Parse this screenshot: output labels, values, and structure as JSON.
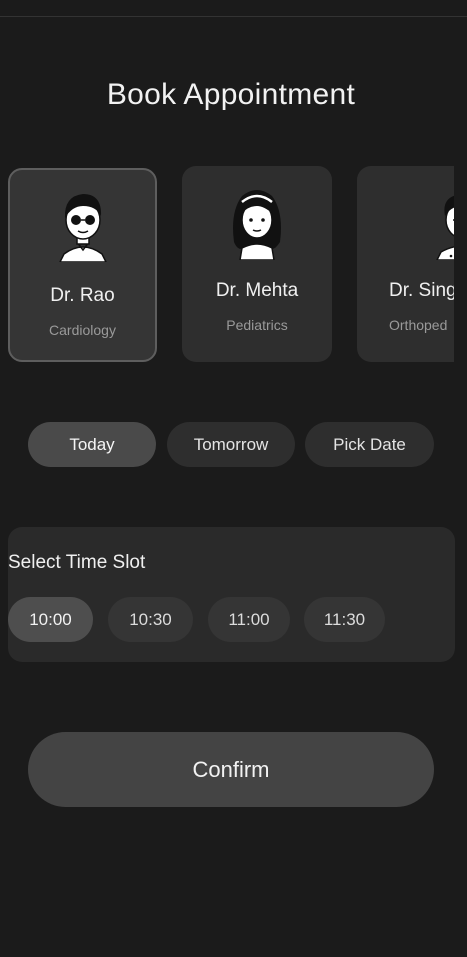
{
  "header": {
    "title": "Book Appointment"
  },
  "doctors": [
    {
      "name": "Dr. Rao",
      "specialty": "Cardiology",
      "avatar_icon": "doctor-sunglasses-avatar-icon",
      "selected": true
    },
    {
      "name": "Dr. Mehta",
      "specialty": "Pediatrics",
      "avatar_icon": "doctor-long-hair-avatar-icon",
      "selected": false
    },
    {
      "name": "Dr. Sing",
      "specialty": "Orthoped",
      "avatar_icon": "doctor-short-hair-avatar-icon",
      "selected": false
    }
  ],
  "date_tabs": [
    {
      "label": "Today",
      "active": true
    },
    {
      "label": "Tomorrow",
      "active": false
    },
    {
      "label": "Pick Date",
      "active": false
    }
  ],
  "time_slots": {
    "heading": "Select Time Slot",
    "slots": [
      {
        "label": "10:00",
        "active": true
      },
      {
        "label": "10:30",
        "active": false
      },
      {
        "label": "11:00",
        "active": false
      },
      {
        "label": "11:30",
        "active": false
      }
    ]
  },
  "confirm": {
    "label": "Confirm"
  },
  "colors": {
    "background": "#1b1b1b",
    "card": "#2e2e2e",
    "selected_border": "#5e5e5e",
    "active_pill": "#4a4a4a"
  }
}
